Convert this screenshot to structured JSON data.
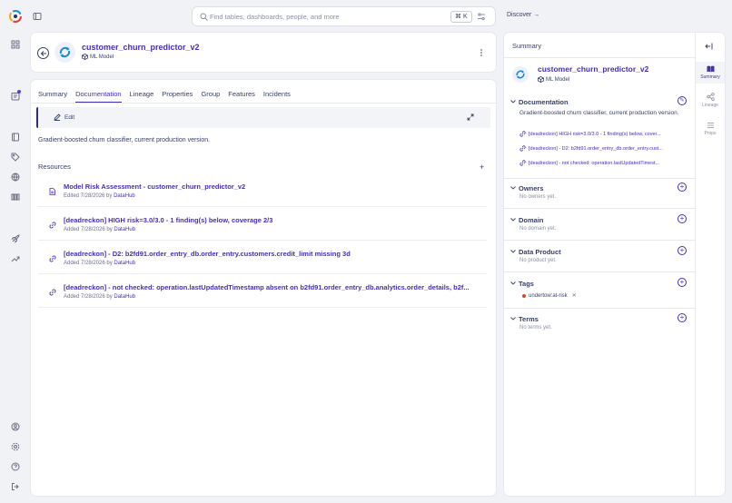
{
  "topbar": {
    "search_placeholder": "Find tables, dashboards, people, and more",
    "shortcut": "⌘ K",
    "discover": "Discover →"
  },
  "entity": {
    "name": "customer_churn_predictor_v2",
    "type": "ML Model"
  },
  "tabs": [
    {
      "label": "Summary"
    },
    {
      "label": "Documentation"
    },
    {
      "label": "Lineage"
    },
    {
      "label": "Properties"
    },
    {
      "label": "Group"
    },
    {
      "label": "Features"
    },
    {
      "label": "Incidents"
    }
  ],
  "active_tab": "Documentation",
  "documentation": {
    "edit_label": "Edit",
    "description": "Gradient-boosted churn classifier, current production version.",
    "resources_title": "Resources",
    "resources": [
      {
        "title": "Model Risk Assessment - customer_churn_predictor_v2",
        "action": "Edited 7/28/2026 by",
        "author": "DataHub",
        "icon": "document-icon"
      },
      {
        "title": "[deadreckon] HIGH risk=3.0/3.0 - 1 finding(s) below, coverage 2/3",
        "action": "Added 7/28/2026 by",
        "author": "DataHub",
        "icon": "link-icon"
      },
      {
        "title": "[deadreckon] - D2: b2fd91.order_entry_db.order_entry.customers.credit_limit missing 3d",
        "action": "Added 7/28/2026 by",
        "author": "DataHub",
        "icon": "link-icon"
      },
      {
        "title": "[deadreckon] - not checked: operation.lastUpdatedTimestamp absent on b2fd91.order_entry_db.analytics.order_details, b2f...",
        "action": "Added 7/28/2026 by",
        "author": "DataHub",
        "icon": "link-icon"
      }
    ]
  },
  "summary": {
    "title": "Summary",
    "side_tabs": [
      {
        "label": "Summary"
      },
      {
        "label": "Lineage"
      },
      {
        "label": "Props"
      }
    ],
    "documentation": {
      "heading": "Documentation",
      "text": "Gradient-boosted churn classifier, current production version.",
      "links": [
        "[deadreckon] HIGH risk=3.0/3.0 - 1 finding(s) below, cover...",
        "[deadreckon] - D2: b2fd91.order_entry_db.order_entry.cust...",
        "[deadreckon] - not checked: operation.lastUpdatedTimest..."
      ]
    },
    "owners": {
      "heading": "Owners",
      "empty": "No owners yet."
    },
    "domain": {
      "heading": "Domain",
      "empty": "No domain yet."
    },
    "data_product": {
      "heading": "Data Product",
      "empty": "No product yet."
    },
    "tags": {
      "heading": "Tags",
      "items": [
        "undertow:at-risk"
      ]
    },
    "terms": {
      "heading": "Terms",
      "empty": "No terms yet."
    }
  },
  "colors": {
    "accent": "#4330b5",
    "tag_dot": "#d14a2a"
  }
}
